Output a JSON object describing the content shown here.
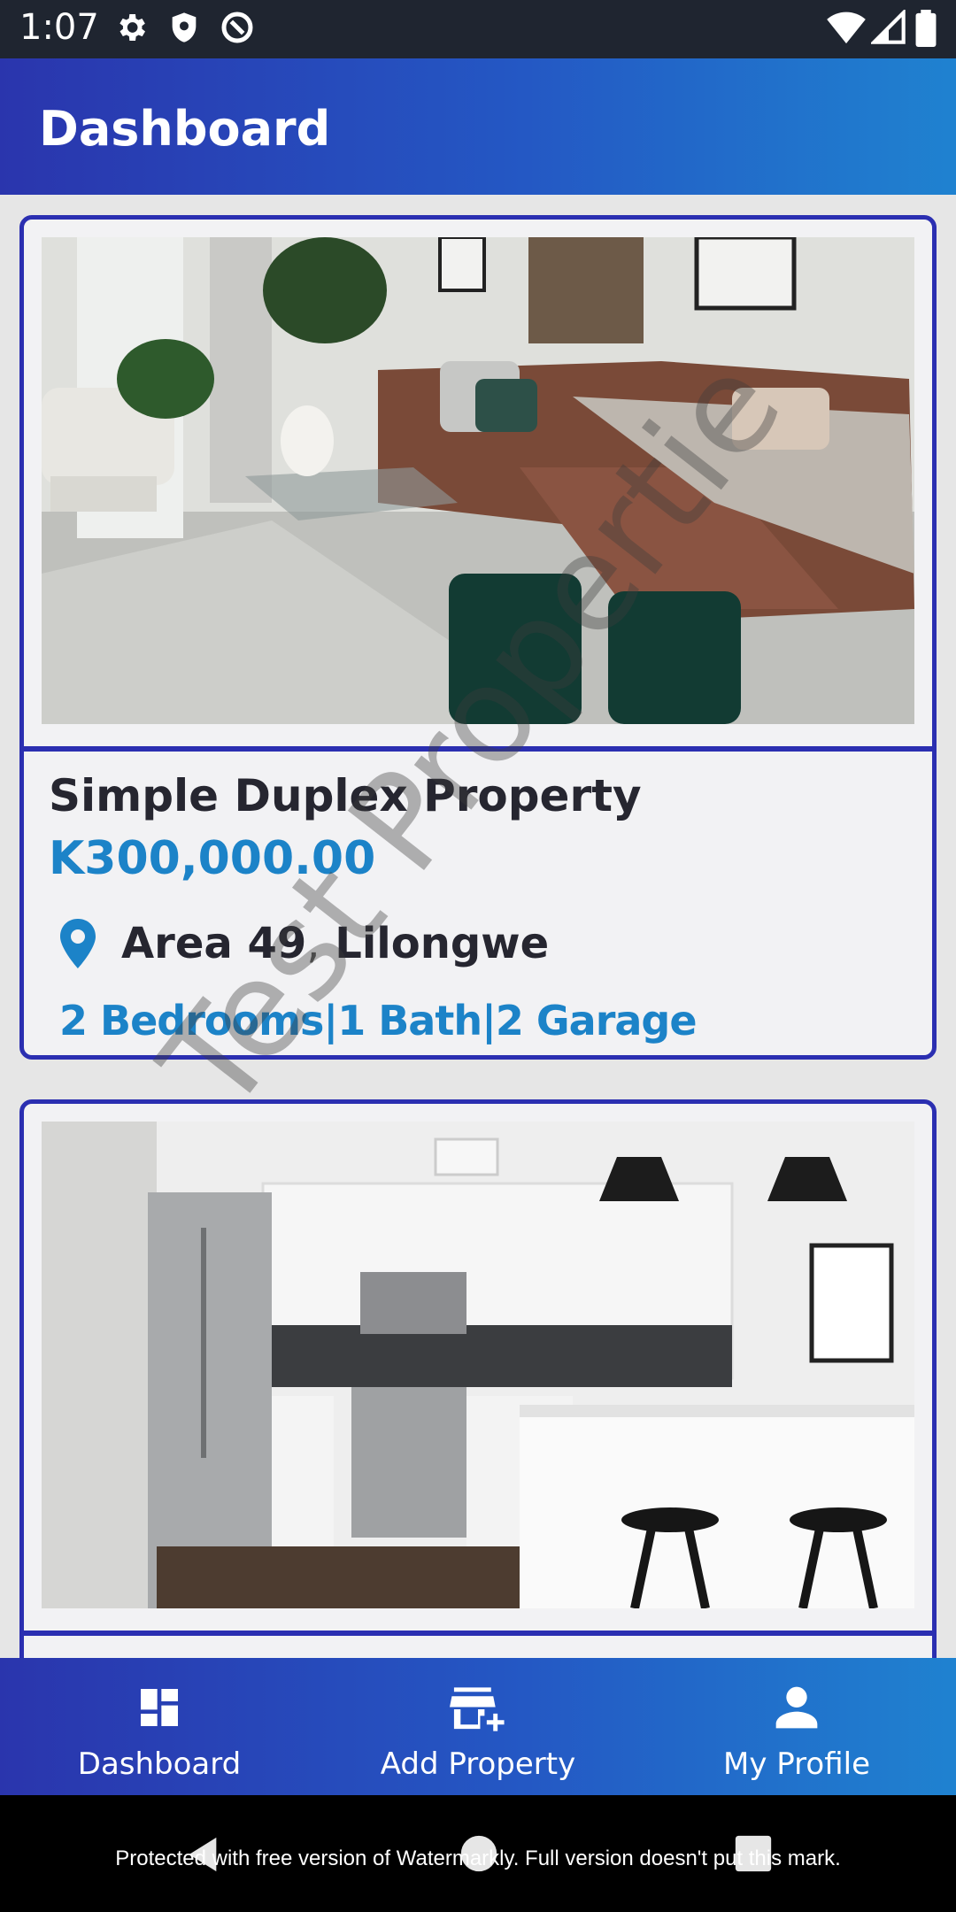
{
  "status_bar": {
    "time": "1:07",
    "icons": [
      "gear-icon",
      "shield-icon",
      "at-sign-icon",
      "wifi-icon",
      "signal-icon",
      "battery-icon"
    ]
  },
  "app_bar": {
    "title": "Dashboard"
  },
  "properties": [
    {
      "title": "Simple Duplex Property",
      "price": "K300,000.00",
      "area": "Area 49",
      "separator": ",",
      "city": "Lilongwe",
      "features": "2 Bedrooms|1 Bath|2 Garage",
      "image": "living-room-photo"
    },
    {
      "image": "kitchen-photo"
    }
  ],
  "watermark": "Test Propertie",
  "bottom_nav": {
    "items": [
      {
        "label": "Dashboard",
        "icon": "dashboard-icon"
      },
      {
        "label": "Add Property",
        "icon": "add-store-icon"
      },
      {
        "label": "My Profile",
        "icon": "person-icon"
      }
    ]
  },
  "footer_note": "Protected with free version of Watermarkly. Full version doesn't put this mark.",
  "colors": {
    "accent_blue": "#1c83c8",
    "card_border": "#2b2fb1",
    "app_bar_start": "#2a35ad",
    "app_bar_end": "#1f82d0"
  }
}
